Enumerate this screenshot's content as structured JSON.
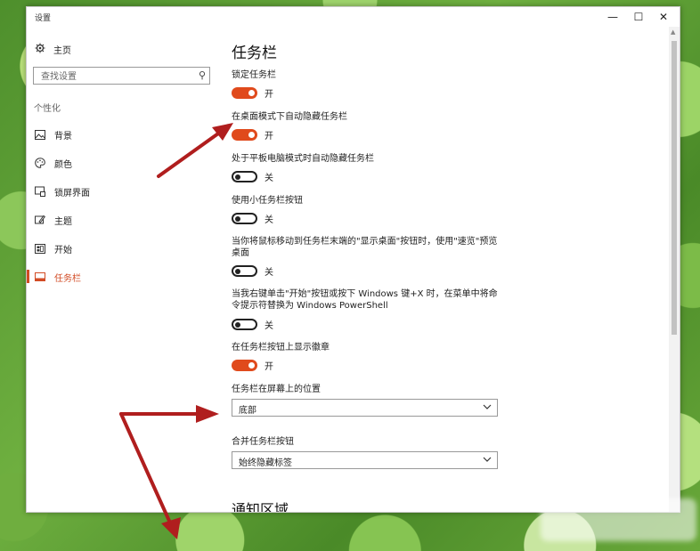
{
  "window": {
    "title": "设置",
    "minimize": "—",
    "maximize": "☐",
    "close": "✕"
  },
  "sidebar": {
    "home": "主页",
    "search_placeholder": "查找设置",
    "section": "个性化",
    "items": [
      {
        "label": "背景",
        "icon": "image-icon"
      },
      {
        "label": "颜色",
        "icon": "palette-icon"
      },
      {
        "label": "锁屏界面",
        "icon": "lock-screen-icon"
      },
      {
        "label": "主题",
        "icon": "theme-icon"
      },
      {
        "label": "开始",
        "icon": "start-icon"
      },
      {
        "label": "任务栏",
        "icon": "taskbar-icon",
        "active": true
      }
    ]
  },
  "main": {
    "title": "任务栏",
    "settings": [
      {
        "label": "锁定任务栏",
        "state": "开"
      },
      {
        "label": "在桌面模式下自动隐藏任务栏",
        "state": "开"
      },
      {
        "label": "处于平板电脑模式时自动隐藏任务栏",
        "state": "关"
      },
      {
        "label": "使用小任务栏按钮",
        "state": "关"
      },
      {
        "label": "当你将鼠标移动到任务栏末端的\"显示桌面\"按钮时，使用\"速览\"预览桌面",
        "state": "关"
      },
      {
        "label": "当我右键单击\"开始\"按钮或按下 Windows 键+X 时，在菜单中将命令提示符替换为 Windows PowerShell",
        "state": "关"
      },
      {
        "label": "在任务栏按钮上显示徽章",
        "state": "开"
      }
    ],
    "position_label": "任务栏在屏幕上的位置",
    "position_value": "底部",
    "combine_label": "合并任务栏按钮",
    "combine_value": "始终隐藏标签",
    "section2_title": "通知区域"
  },
  "colors": {
    "accent": "#d24b24",
    "toggle_on": "#e04a1c",
    "annotation_arrow": "#b01e1e"
  }
}
